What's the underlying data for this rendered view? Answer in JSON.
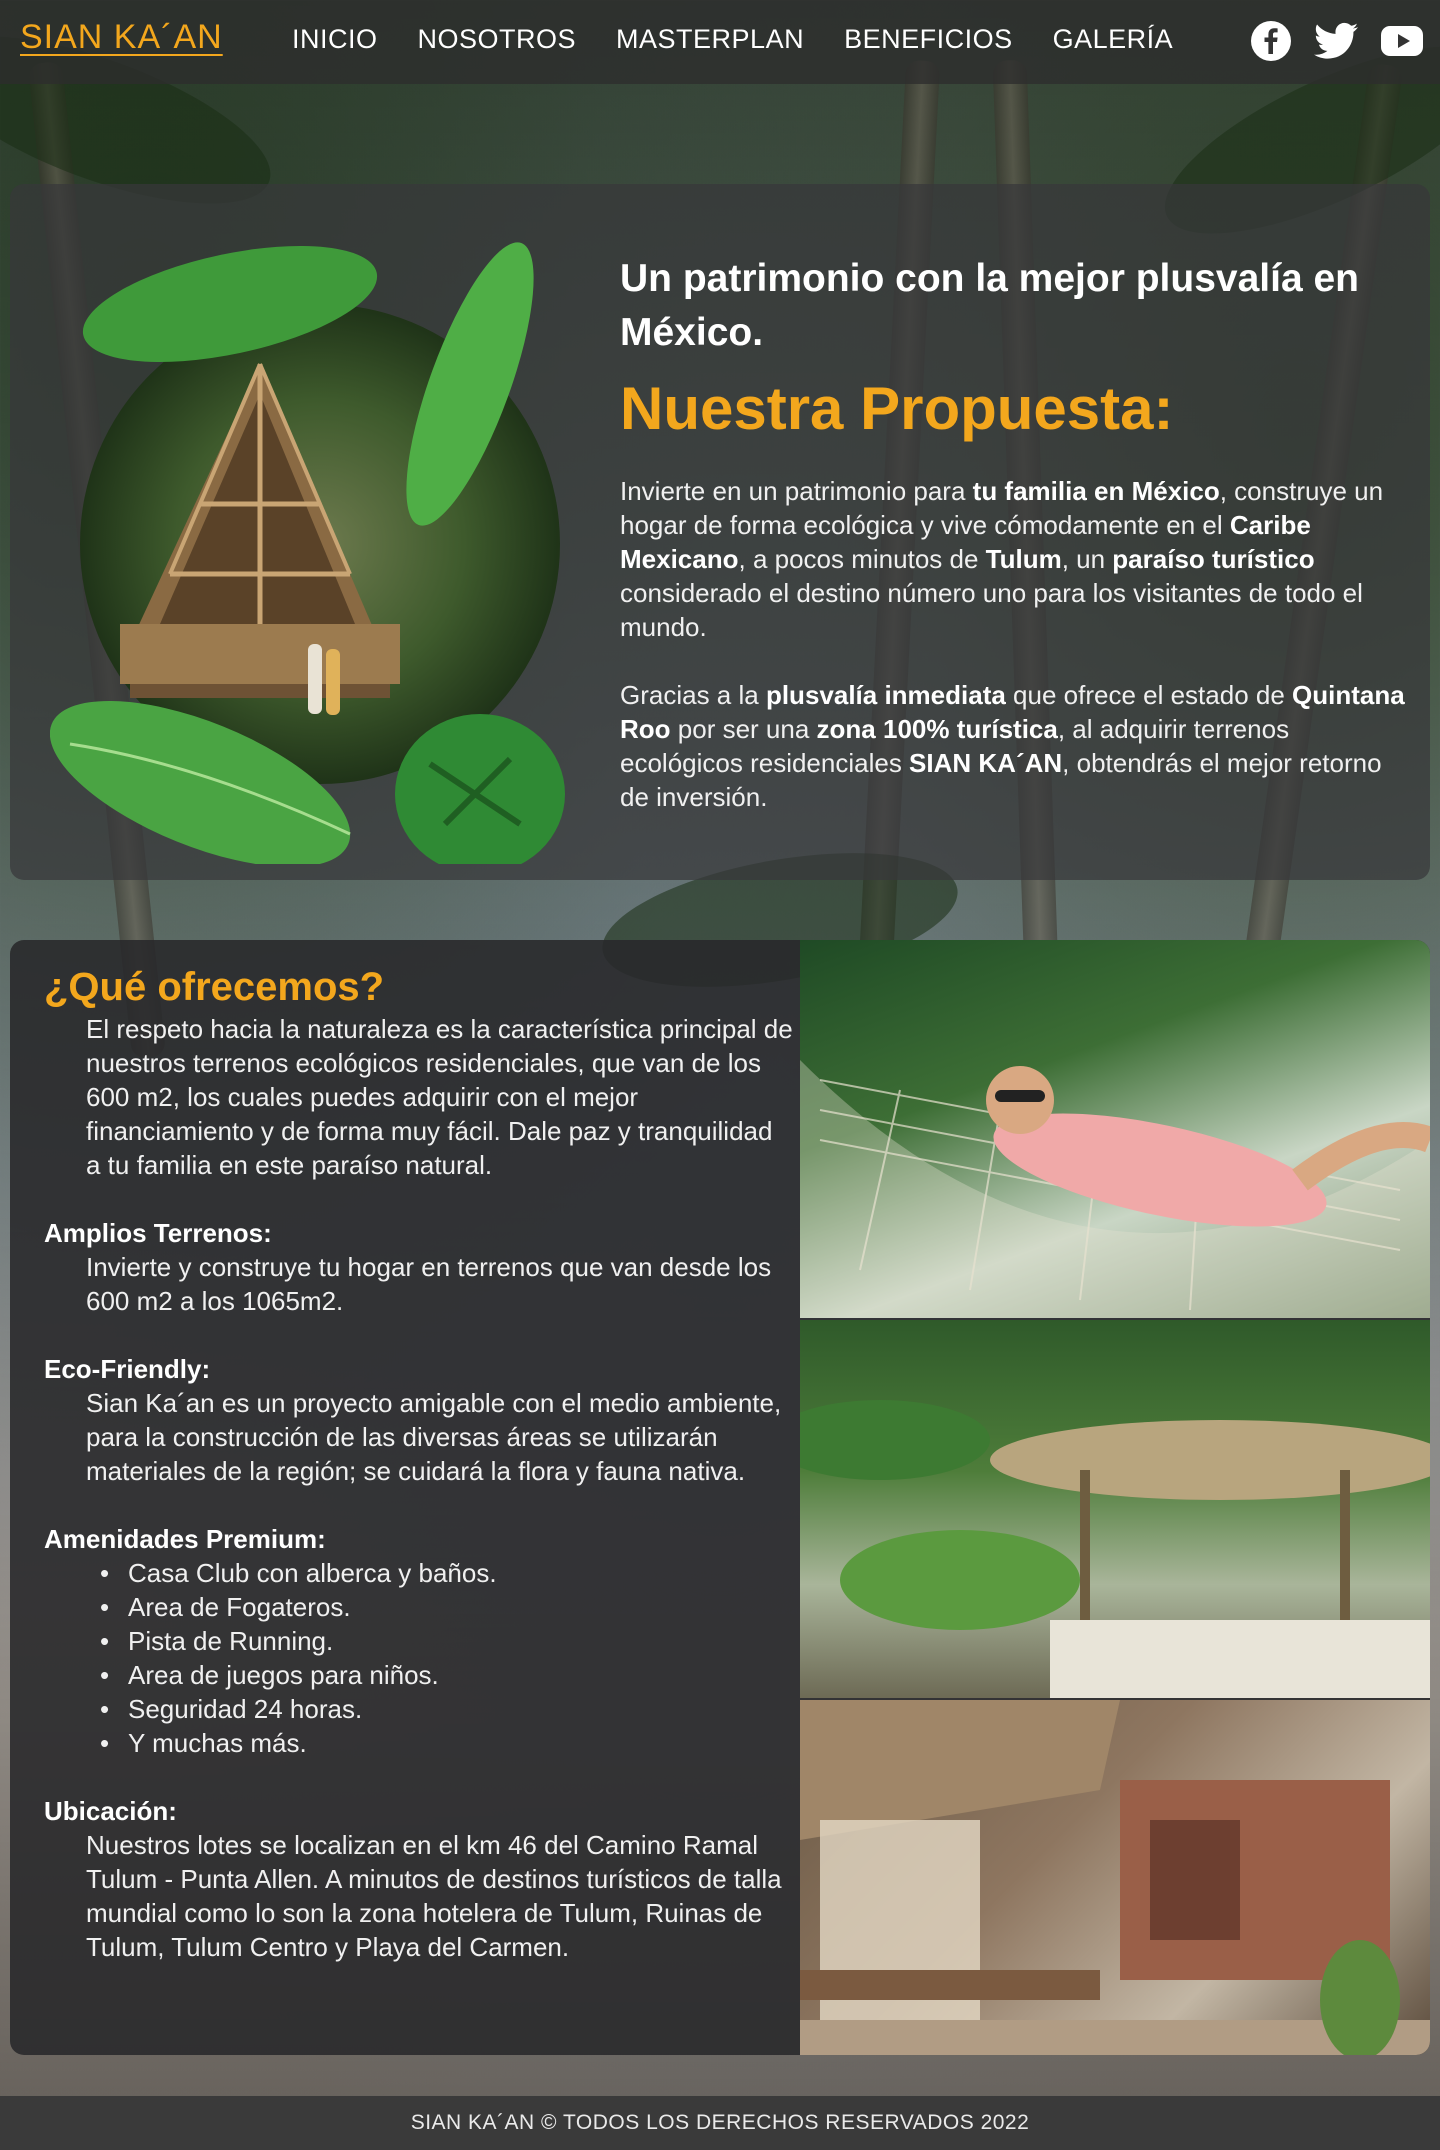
{
  "brand": {
    "logo": "SIAN KA´AN",
    "accent": "#f3a71d"
  },
  "nav": {
    "items": [
      "INICIO",
      "NOSOTROS",
      "MASTERPLAN",
      "BENEFICIOS",
      "GALERÍA"
    ],
    "social": [
      "facebook-icon",
      "twitter-icon",
      "youtube-icon"
    ]
  },
  "proposal": {
    "tagline": "Un patrimonio con la mejor plusvalía en México.",
    "title": "Nuestra Propuesta:",
    "p1": {
      "t1": "Invierte en un patrimonio para ",
      "b1": "tu familia en México",
      "t2": ", construye un hogar de forma ecológica y vive cómodamente en el ",
      "b2": "Caribe Mexicano",
      "t3": ", a pocos minutos de ",
      "b3": "Tulum",
      "t4": ", un ",
      "b4": "paraíso turístico",
      "t5": " considerado el destino número uno para los visitantes de todo el mundo."
    },
    "p2": {
      "t1": "Gracias a la ",
      "b1": "plusvalía inmediata",
      "t2": " que ofrece el estado de ",
      "b2": "Quintana Roo",
      "t3": " por ser una ",
      "b3": "zona 100% turística",
      "t4": ", al adquirir terrenos ecológicos residenciales ",
      "b4": "SIAN KA´AN",
      "t5": ", obtendrás el mejor retorno de inversión."
    }
  },
  "offer": {
    "title": "¿Qué ofrecemos?",
    "intro": "El respeto hacia la naturaleza es la característica principal de nuestros terrenos ecológicos residenciales, que van de los 600 m2, los cuales puedes adquirir con el mejor financiamiento y de forma muy fácil. Dale paz y tranquilidad a tu familia en este paraíso natural.",
    "terrenos_title": "Amplios Terrenos:",
    "terrenos_text": "Invierte y construye tu hogar en terrenos que van desde los 600 m2 a los 1065m2.",
    "eco_title": "Eco-Friendly:",
    "eco_text": "Sian Ka´an es un proyecto amigable con el medio ambiente, para la construcción de las diversas áreas se utilizarán materiales de la región; se cuidará la flora y fauna nativa.",
    "amen_title": "Amenidades Premium:",
    "amenities": [
      "Casa Club con alberca y baños.",
      "Area de Fogateros.",
      "Pista de Running.",
      "Area de juegos para niños.",
      "Seguridad 24 horas.",
      "Y muchas más."
    ],
    "ubic_title": "Ubicación:",
    "ubic_text": "Nuestros lotes se localizan en el km 46 del Camino Ramal Tulum - Punta Allen. A minutos de destinos turísticos de talla mundial como lo son la zona hotelera de Tulum, Ruinas de Tulum, Tulum Centro y Playa del Carmen."
  },
  "footer": {
    "text": "SIAN KA´AN © TODOS LOS DERECHOS RESERVADOS 2022"
  }
}
